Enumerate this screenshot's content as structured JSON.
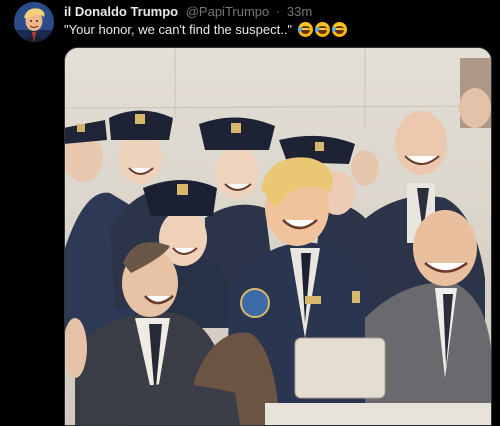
{
  "post": {
    "display_name": "il Donaldo Trumpo",
    "handle": "@PapiTrumpo",
    "separator": "·",
    "timestamp": "33m",
    "text": "\"Your honor, we can't find the suspect..\"",
    "emojis": [
      "face-with-tears-of-joy",
      "face-with-tears-of-joy",
      "face-with-tears-of-joy"
    ]
  },
  "colors": {
    "background": "#000000",
    "primary_text": "#e7e9ea",
    "secondary_text": "#71767b",
    "uniform": "#2b3448",
    "sketch_paper": "#ddd8cf"
  },
  "media": {
    "kind": "sketch-illustration",
    "icons": [
      "avatar-photo",
      "police-officers-illustration"
    ]
  }
}
